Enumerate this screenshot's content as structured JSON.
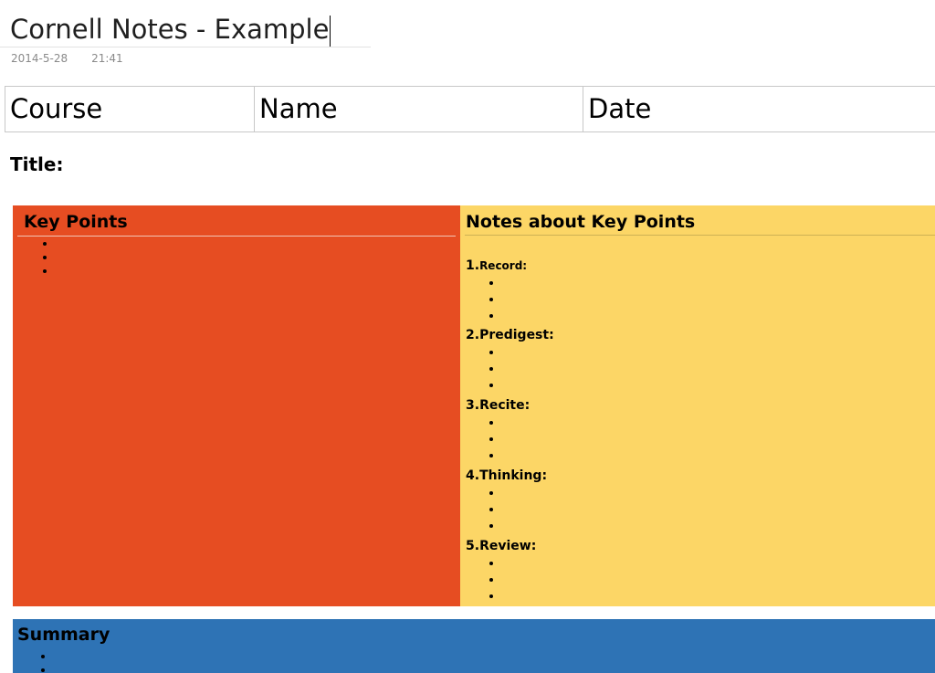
{
  "page": {
    "title": "Cornell Notes - Example",
    "date": "2014-5-28",
    "time": "21:41"
  },
  "header_table": {
    "course": "Course",
    "name": "Name",
    "date": "Date"
  },
  "doc_title": "Title:",
  "key_points": {
    "heading": "Key Points",
    "bullet_count": 3,
    "color": "#e64d22"
  },
  "notes": {
    "heading": "Notes about Key Points",
    "color": "#fcd666",
    "sections": [
      {
        "number": "1.",
        "name": "Record:"
      },
      {
        "number": "2.",
        "name": "Predigest:"
      },
      {
        "number": "3.",
        "name": "Recite:"
      },
      {
        "number": "4.",
        "name": "Thinking:"
      },
      {
        "number": "5.",
        "name": "Review:"
      }
    ]
  },
  "summary": {
    "heading": "Summary",
    "color": "#2e73b5"
  }
}
